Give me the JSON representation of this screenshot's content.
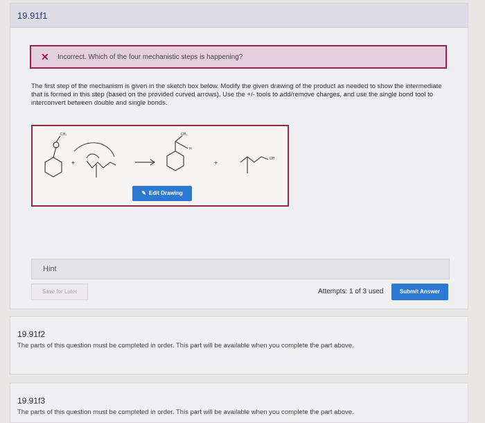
{
  "part1": {
    "title": "19.91f1",
    "feedback": {
      "icon": "close-icon",
      "color": "#a8184a",
      "message": "Incorrect. Which of the four mechanistic steps is happening?"
    },
    "instructions": "The first step of the mechanism is given in the sketch box below. Modify the given drawing of the product as needed to show the intermediate that is formed in this step (based on the provided curved arrows). Use the +/- tools to add/remove charges, and use the single bond tool to interconvert between double and single bonds.",
    "sketch": {
      "labels": {
        "ch3_left": "CH₃",
        "ch3_right": "CH₃",
        "oh": "OH",
        "plus1": "+",
        "plus2": "+",
        "h": "H"
      },
      "edit_label": "Edit Drawing"
    },
    "hint_label": "Hint",
    "save_label": "Save for Later",
    "attempts": "Attempts: 1 of 3 used",
    "submit_label": "Submit Answer"
  },
  "part2": {
    "title": "19.91f2",
    "message": "The parts of this question must be completed in order. This part will be available when you complete the part above."
  },
  "part3": {
    "title": "19.91f3",
    "message": "The parts of this question must be completed in order. This part will be available when you complete the part above."
  },
  "colors": {
    "accent": "#2b79d3",
    "error": "#a8184a"
  }
}
